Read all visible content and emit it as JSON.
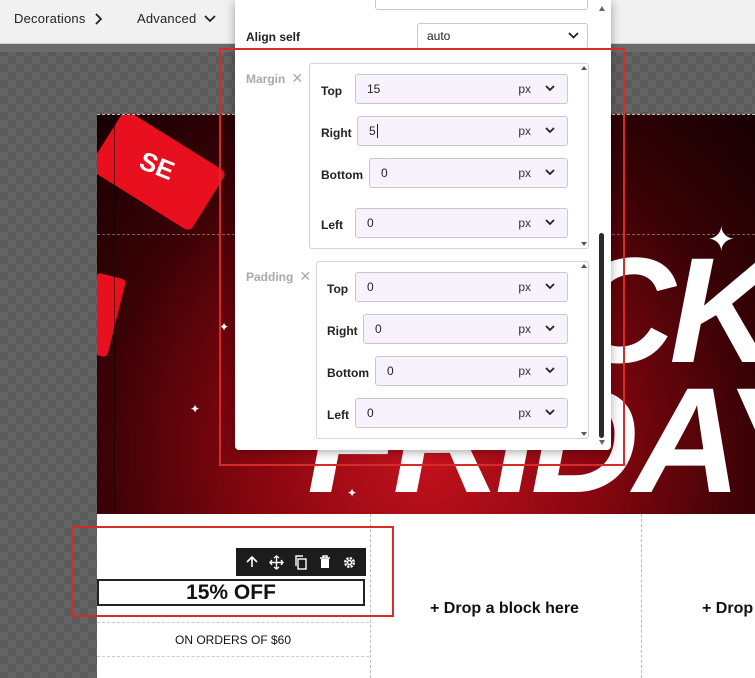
{
  "toolbar": {
    "decorations_label": "Decorations",
    "advanced_label": "Advanced"
  },
  "panel": {
    "align_self": {
      "label": "Align self",
      "value": "auto"
    },
    "margin": {
      "label": "Margin",
      "top": {
        "label": "Top",
        "value": "15",
        "unit": "px"
      },
      "right": {
        "label": "Right",
        "value": "5",
        "unit": "px"
      },
      "bottom": {
        "label": "Bottom",
        "value": "0",
        "unit": "px"
      },
      "left": {
        "label": "Left",
        "value": "0",
        "unit": "px"
      }
    },
    "padding": {
      "label": "Padding",
      "top": {
        "label": "Top",
        "value": "0",
        "unit": "px"
      },
      "right": {
        "label": "Right",
        "value": "0",
        "unit": "px"
      },
      "bottom": {
        "label": "Bottom",
        "value": "0",
        "unit": "px"
      },
      "left": {
        "label": "Left",
        "value": "0",
        "unit": "px"
      }
    }
  },
  "canvas": {
    "discount_text": "15% OFF",
    "orders_text": "ON ORDERS OF $60",
    "drop_text_1": "+ Drop a block here",
    "drop_text_2": "+ Drop"
  },
  "colors": {
    "highlight_red": "#d52b2b",
    "hero_red": "#c4121e",
    "input_bg": "#f7f2fb"
  },
  "icons": {
    "block_toolbar": [
      "arrow-up-icon",
      "move-icon",
      "copy-icon",
      "delete-icon",
      "gear-icon"
    ]
  }
}
